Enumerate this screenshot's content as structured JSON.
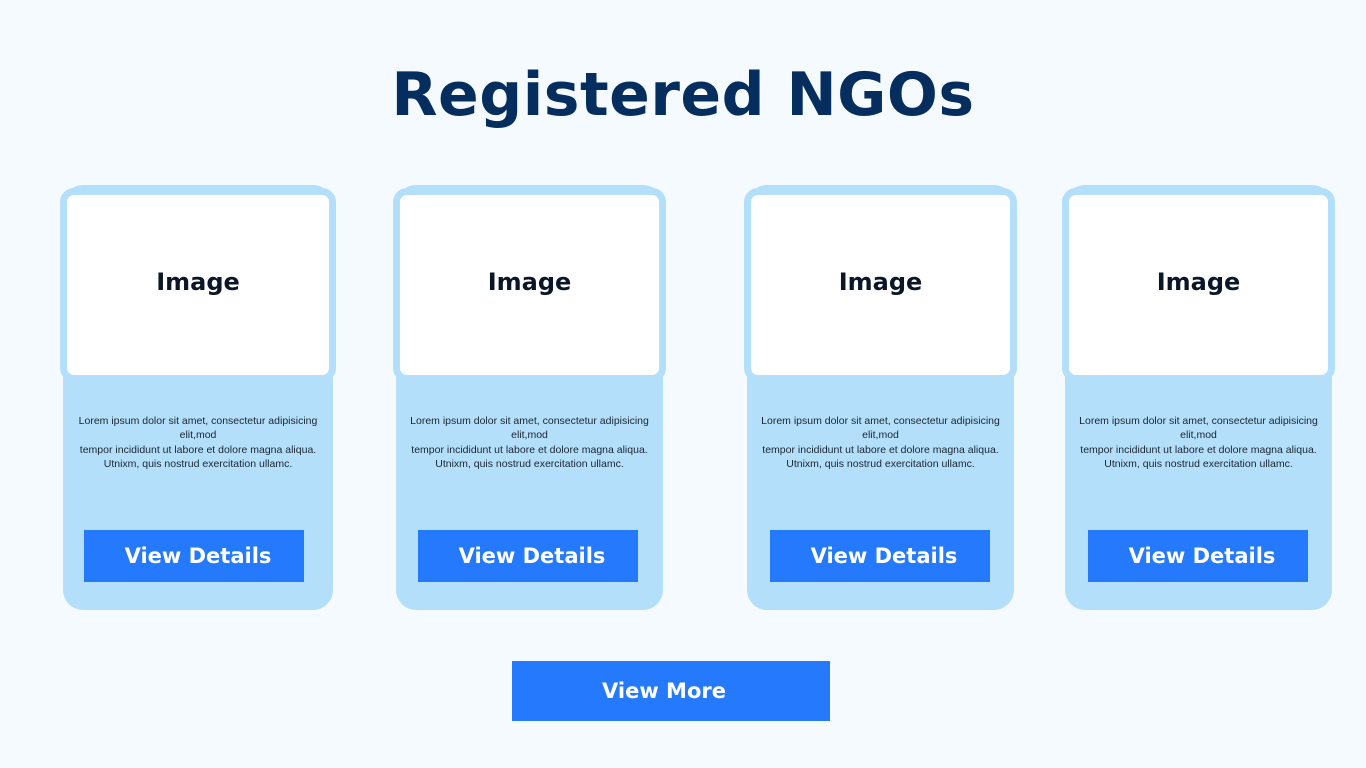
{
  "page": {
    "title": "Registered NGOs",
    "view_more_label": "View More"
  },
  "colors": {
    "background": "#f5faff",
    "title": "#052d5e",
    "card": "#b3dffb",
    "button": "#2479fc",
    "button_text": "#ffffff"
  },
  "cards": [
    {
      "image_label": "Image",
      "desc_lines": [
        "Lorem ipsum dolor sit amet, consectetur adipisicing elit,mod",
        "tempor incididunt ut labore et dolore magna aliqua.",
        "Utnixm, quis nostrud exercitation ullamc."
      ],
      "button_label": "View Details"
    },
    {
      "image_label": "Image",
      "desc_lines": [
        "Lorem ipsum dolor sit amet, consectetur adipisicing elit,mod",
        "tempor incididunt ut labore et dolore magna aliqua.",
        "Utnixm, quis nostrud exercitation ullamc."
      ],
      "button_label": "View Details"
    },
    {
      "image_label": "Image",
      "desc_lines": [
        "Lorem ipsum dolor sit amet, consectetur adipisicing elit,mod",
        "tempor incididunt ut labore et dolore magna aliqua.",
        "Utnixm, quis nostrud exercitation ullamc."
      ],
      "button_label": "View Details"
    },
    {
      "image_label": "Image",
      "desc_lines": [
        "Lorem ipsum dolor sit amet, consectetur adipisicing elit,mod",
        "tempor incididunt ut labore et dolore magna aliqua.",
        "Utnixm, quis nostrud exercitation ullamc."
      ],
      "button_label": "View Details"
    }
  ]
}
